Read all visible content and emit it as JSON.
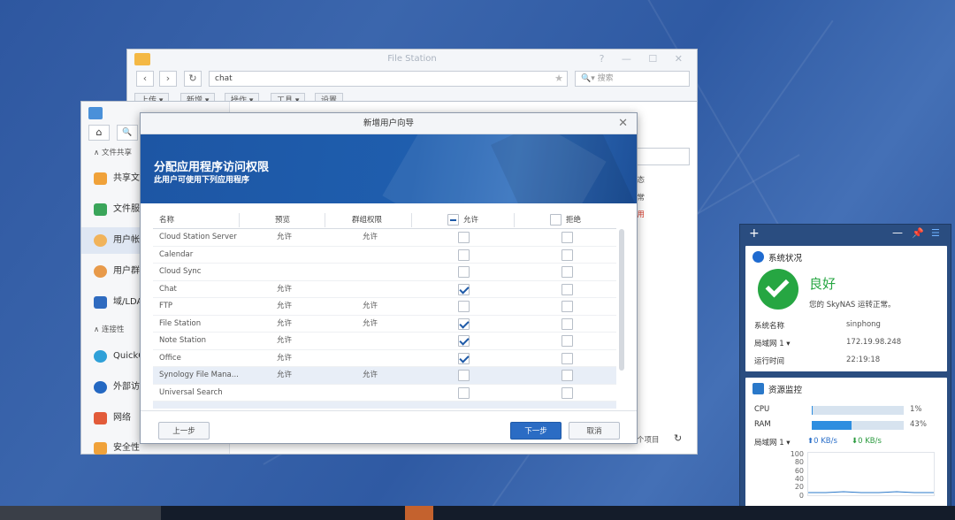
{
  "file_station": {
    "title": "File Station",
    "address": "chat",
    "search_placeholder": "搜索",
    "tools": [
      "上传",
      "新增",
      "操作",
      "工具",
      "设置"
    ]
  },
  "control_panel": {
    "sidebar": {
      "section_file_sharing": "文件共享",
      "items_1": [
        {
          "label": "共享文件夹"
        },
        {
          "label": "文件服务"
        },
        {
          "label": "用户帐号"
        },
        {
          "label": "用户群组"
        },
        {
          "label": "域/LDAP"
        }
      ],
      "section_connectivity": "连接性",
      "items_2": [
        {
          "label": "QuickConnect"
        },
        {
          "label": "外部访问"
        },
        {
          "label": "网络"
        },
        {
          "label": "安全性"
        }
      ]
    },
    "right_col_header": "状态",
    "right_col_values": [
      "正常",
      "停用"
    ],
    "item_count": "个项目"
  },
  "wizard": {
    "title": "新增用户向导",
    "banner_title": "分配应用程序访问权限",
    "banner_subtitle": "此用户可使用下列应用程序",
    "columns": {
      "name": "名称",
      "preview": "预览",
      "group": "群组权限",
      "allow": "允许",
      "deny": "拒绝"
    },
    "rows": [
      {
        "name": "Cloud Station Server",
        "preview": "允许",
        "group": "允许",
        "allow": false,
        "deny": false
      },
      {
        "name": "Calendar",
        "preview": "",
        "group": "",
        "allow": false,
        "deny": false
      },
      {
        "name": "Cloud Sync",
        "preview": "",
        "group": "",
        "allow": false,
        "deny": false
      },
      {
        "name": "Chat",
        "preview": "允许",
        "group": "",
        "allow": true,
        "deny": false
      },
      {
        "name": "FTP",
        "preview": "允许",
        "group": "允许",
        "allow": false,
        "deny": false
      },
      {
        "name": "File Station",
        "preview": "允许",
        "group": "允许",
        "allow": true,
        "deny": false
      },
      {
        "name": "Note Station",
        "preview": "允许",
        "group": "",
        "allow": true,
        "deny": false
      },
      {
        "name": "Office",
        "preview": "允许",
        "group": "",
        "allow": true,
        "deny": false
      },
      {
        "name": "Synology File Mana...",
        "preview": "允许",
        "group": "允许",
        "allow": false,
        "deny": false
      },
      {
        "name": "Universal Search",
        "preview": "",
        "group": "",
        "allow": false,
        "deny": false
      }
    ],
    "buttons": {
      "prev": "上一步",
      "next": "下一步",
      "cancel": "取消"
    }
  },
  "widget": {
    "status": {
      "title": "系统状况",
      "state": "良好",
      "message": "您的 SkyNAS 运转正常。",
      "fields": [
        {
          "label": "系统名称",
          "value": "sinphong"
        },
        {
          "label": "局域网 1 ▾",
          "value": "172.19.98.248"
        },
        {
          "label": "运行时间",
          "value": "22:19:18"
        }
      ]
    },
    "monitor": {
      "title": "资源监控",
      "cpu_label": "CPU",
      "cpu_value": "1%",
      "cpu_fraction": 0.01,
      "ram_label": "RAM",
      "ram_value": "43%",
      "ram_fraction": 0.43,
      "lan_label": "局域网 1 ▾",
      "upload": "0 KB/s",
      "download": "0 KB/s",
      "axis": [
        "100",
        "80",
        "60",
        "40",
        "20",
        "0"
      ]
    }
  }
}
